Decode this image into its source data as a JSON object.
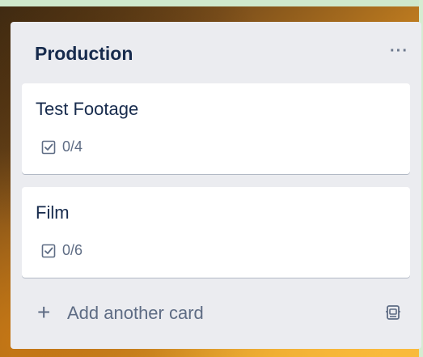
{
  "list": {
    "title": "Production",
    "menu_label": "···",
    "cards": [
      {
        "title": "Test Footage",
        "checklist": "0/4",
        "badge_icon": "checklist-icon"
      },
      {
        "title": "Film",
        "checklist": "0/6",
        "badge_icon": "checklist-icon"
      }
    ],
    "add_card": {
      "plus": "+",
      "label": "Add another card",
      "template_icon": "card-template-icon"
    }
  },
  "colors": {
    "list_bg": "#ebecf0",
    "card_bg": "#ffffff",
    "title_text": "#172b4d",
    "muted_text": "#5e6c84"
  }
}
